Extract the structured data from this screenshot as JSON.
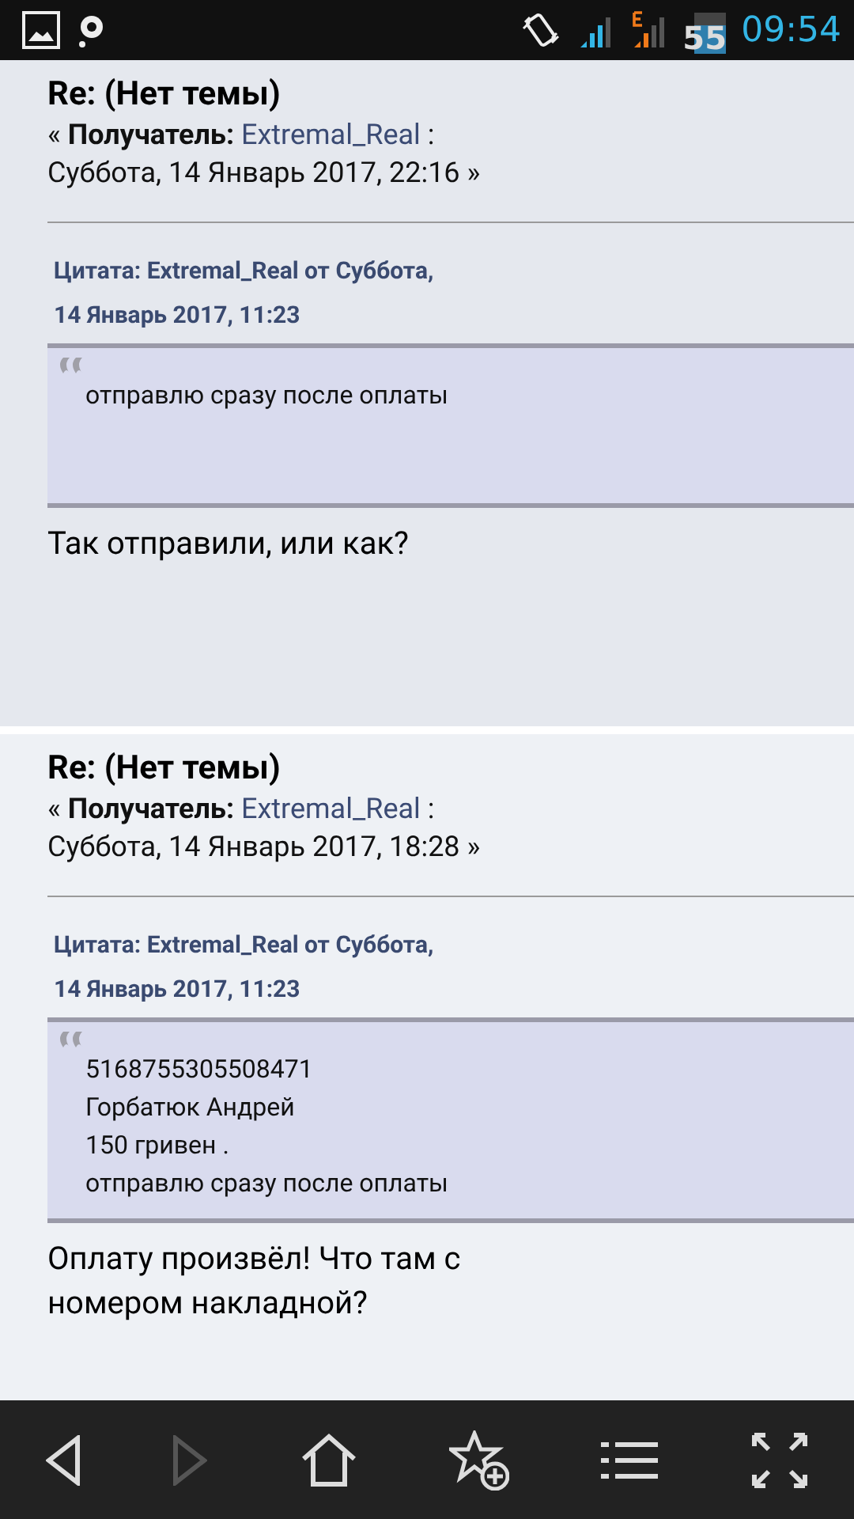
{
  "status_bar": {
    "battery": "55",
    "time": "09:54"
  },
  "posts": [
    {
      "title": "Re: (Нет темы)",
      "open_mark": "«",
      "recipient_label": "Получатель:",
      "recipient": "Extremal_Real",
      "separator": ":",
      "date": "Суббота, 14 Январь 2017, 22:16",
      "close_mark": "»",
      "quote": {
        "header": "Цитата: Extremal_Real от Суббота,",
        "header_date": "14  Январь 2017, 11:23",
        "lines": [
          "отправлю сразу после оплаты"
        ]
      },
      "body": "Так отправили, или как?"
    },
    {
      "title": "Re: (Нет темы)",
      "open_mark": "«",
      "recipient_label": "Получатель:",
      "recipient": "Extremal_Real",
      "separator": ":",
      "date": "Суббота, 14 Январь 2017, 18:28",
      "close_mark": "»",
      "quote": {
        "header": "Цитата: Extremal_Real от Суббота,",
        "header_date": "14  Январь 2017, 11:23",
        "lines": [
          "5168755305508471",
          "Горбатюк Андрей",
          "150 гривен .",
          "отправлю сразу после оплаты"
        ]
      },
      "body": "Оплату произвёл! Что там с номером накладной?"
    }
  ],
  "toolbar": [
    {
      "kind": "back",
      "disabled": false
    },
    {
      "kind": "forward",
      "disabled": true
    },
    {
      "kind": "home",
      "disabled": false
    },
    {
      "kind": "bookmark",
      "disabled": false
    },
    {
      "kind": "list",
      "disabled": false
    },
    {
      "kind": "fullscreen",
      "disabled": false
    }
  ]
}
